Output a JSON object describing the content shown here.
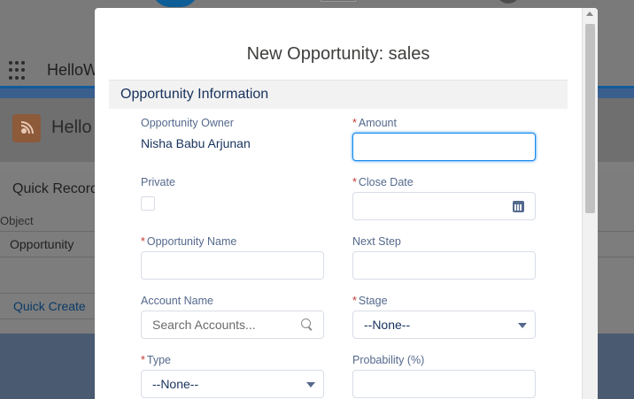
{
  "background": {
    "app_title": "HelloW",
    "page_title": "Hello",
    "quick_card_title": "Quick Record",
    "object_label": "Object",
    "object_value": "Opportunity",
    "quick_create_button": "Quick Create"
  },
  "modal": {
    "title": "New Opportunity: sales",
    "section_title": "Opportunity Information",
    "fields": {
      "owner": {
        "label": "Opportunity Owner",
        "value": "Nisha Babu Arjunan"
      },
      "amount": {
        "label": "Amount",
        "value": ""
      },
      "private": {
        "label": "Private",
        "checked": false
      },
      "close_date": {
        "label": "Close Date",
        "value": ""
      },
      "opportunity_name": {
        "label": "Opportunity Name",
        "value": ""
      },
      "next_step": {
        "label": "Next Step",
        "value": ""
      },
      "account_name": {
        "label": "Account Name",
        "placeholder": "Search Accounts..."
      },
      "stage": {
        "label": "Stage",
        "value": "--None--"
      },
      "type": {
        "label": "Type",
        "value": "--None--"
      },
      "probability": {
        "label": "Probability (%)",
        "value": ""
      }
    },
    "required_marker": "*"
  },
  "colors": {
    "required": "#c23934",
    "focus": "#1589ee",
    "label": "#54698d",
    "section_header_bg": "#f3f2f2"
  }
}
